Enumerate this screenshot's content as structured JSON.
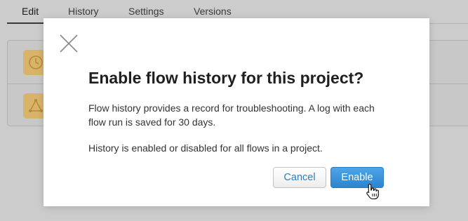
{
  "tabs": [
    {
      "label": "Edit"
    },
    {
      "label": "History"
    },
    {
      "label": "Settings"
    },
    {
      "label": "Versions"
    }
  ],
  "list": {
    "items": [
      {
        "icon": "clock-icon"
      },
      {
        "icon": "flow-icon"
      }
    ]
  },
  "modal": {
    "title": "Enable flow history for this project?",
    "paragraph1": "Flow history provides a record for troubleshooting. A log with each flow run is saved for 30 days.",
    "paragraph2": "History is enabled or disabled for all flows in a project.",
    "cancel_label": "Cancel",
    "enable_label": "Enable",
    "close_icon": "close-icon"
  },
  "colors": {
    "accent": "#2f7fbf",
    "primary_button": "#3590d8",
    "backdrop": "#cccccc",
    "list_icon_bg": "#d8b46b"
  }
}
